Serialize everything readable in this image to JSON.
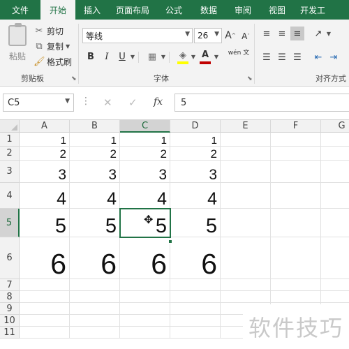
{
  "ribbon_tabs": [
    "文件",
    "开始",
    "插入",
    "页面布局",
    "公式",
    "数据",
    "审阅",
    "视图",
    "开发工"
  ],
  "clipboard": {
    "paste_label": "粘贴",
    "cut_label": "剪切",
    "copy_label": "复制",
    "format_painter_label": "格式刷",
    "group_label": "剪贴板"
  },
  "font": {
    "family": "等线",
    "size": "26",
    "grow_label": "A",
    "shrink_label": "A",
    "bold_label": "B",
    "italic_label": "I",
    "underline_label": "U",
    "font_color_label": "A",
    "phonetic_label": "wén 文",
    "group_label": "字体"
  },
  "alignment": {
    "group_label": "对齐方式"
  },
  "formula_bar": {
    "name_box": "C5",
    "fx_label": "fx",
    "value": "5"
  },
  "columns": [
    "A",
    "B",
    "C",
    "D",
    "E",
    "F",
    "G"
  ],
  "rows": [
    {
      "num": "1",
      "values": [
        "1",
        "1",
        "1",
        "1"
      ]
    },
    {
      "num": "2",
      "values": [
        "2",
        "2",
        "2",
        "2"
      ]
    },
    {
      "num": "3",
      "values": [
        "3",
        "3",
        "3",
        "3"
      ]
    },
    {
      "num": "4",
      "values": [
        "4",
        "4",
        "4",
        "4"
      ]
    },
    {
      "num": "5",
      "values": [
        "5",
        "5",
        "5",
        "5"
      ]
    },
    {
      "num": "6",
      "values": [
        "6",
        "6",
        "6",
        "6"
      ]
    },
    {
      "num": "7",
      "values": [
        "",
        "",
        "",
        ""
      ]
    },
    {
      "num": "8",
      "values": [
        "",
        "",
        "",
        ""
      ]
    },
    {
      "num": "9",
      "values": [
        "",
        "",
        "",
        ""
      ]
    },
    {
      "num": "10",
      "values": [
        "",
        "",
        "",
        ""
      ]
    },
    {
      "num": "11",
      "values": [
        "",
        "",
        "",
        ""
      ]
    }
  ],
  "selected": {
    "column": "C",
    "row": "5"
  },
  "watermark": "软件技巧",
  "colors": {
    "accent": "#217346"
  }
}
